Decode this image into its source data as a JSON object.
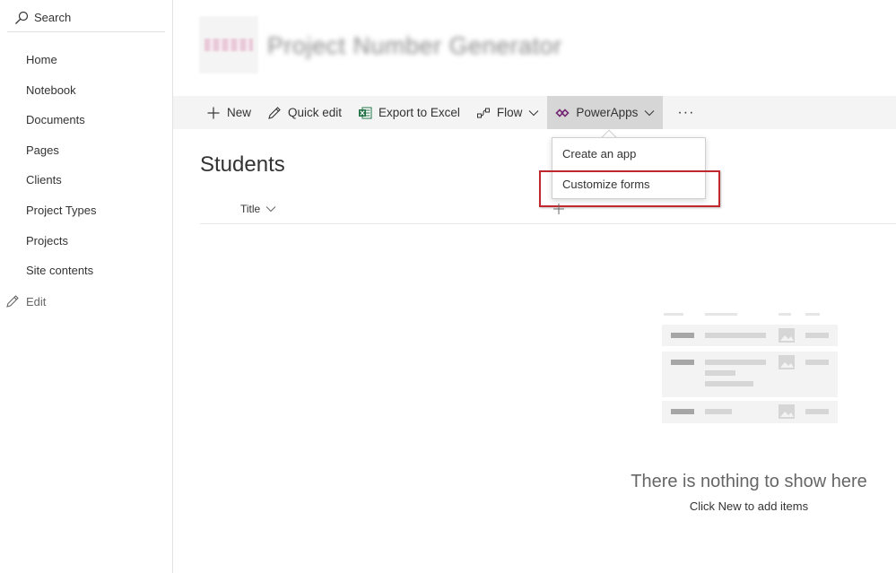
{
  "leftnav": {
    "search_label": "Search",
    "items": [
      {
        "label": "Home"
      },
      {
        "label": "Notebook"
      },
      {
        "label": "Documents"
      },
      {
        "label": "Pages"
      },
      {
        "label": "Clients"
      },
      {
        "label": "Project Types"
      },
      {
        "label": "Projects"
      },
      {
        "label": "Site contents"
      }
    ],
    "edit_label": "Edit"
  },
  "site": {
    "title": "Project Number Generator"
  },
  "commandbar": {
    "new_label": "New",
    "quick_edit_label": "Quick edit",
    "export_label": "Export to Excel",
    "flow_label": "Flow",
    "powerapps_label": "PowerApps",
    "more_label": "···"
  },
  "powerapps_menu": {
    "items": [
      {
        "label": "Create an app"
      },
      {
        "label": "Customize forms"
      }
    ],
    "highlighted_item": "Customize forms"
  },
  "list": {
    "title": "Students",
    "columns": [
      {
        "label": "Title"
      }
    ]
  },
  "empty_state": {
    "title": "There is nothing to show here",
    "subtitle": "Click New to add items"
  },
  "colors": {
    "command_bar_bg": "#f4f4f4",
    "active_command_bg": "#d6d6d6",
    "highlight_border": "#c0282d",
    "excel_green": "#217346",
    "powerapps_purple": "#742774"
  },
  "icons": {
    "search": "search-icon",
    "edit": "pencil-icon",
    "new": "plus-icon",
    "quick_edit": "pencil-icon",
    "export": "excel-icon",
    "flow": "flow-icon",
    "powerapps": "powerapps-icon",
    "add_column": "plus-icon"
  }
}
